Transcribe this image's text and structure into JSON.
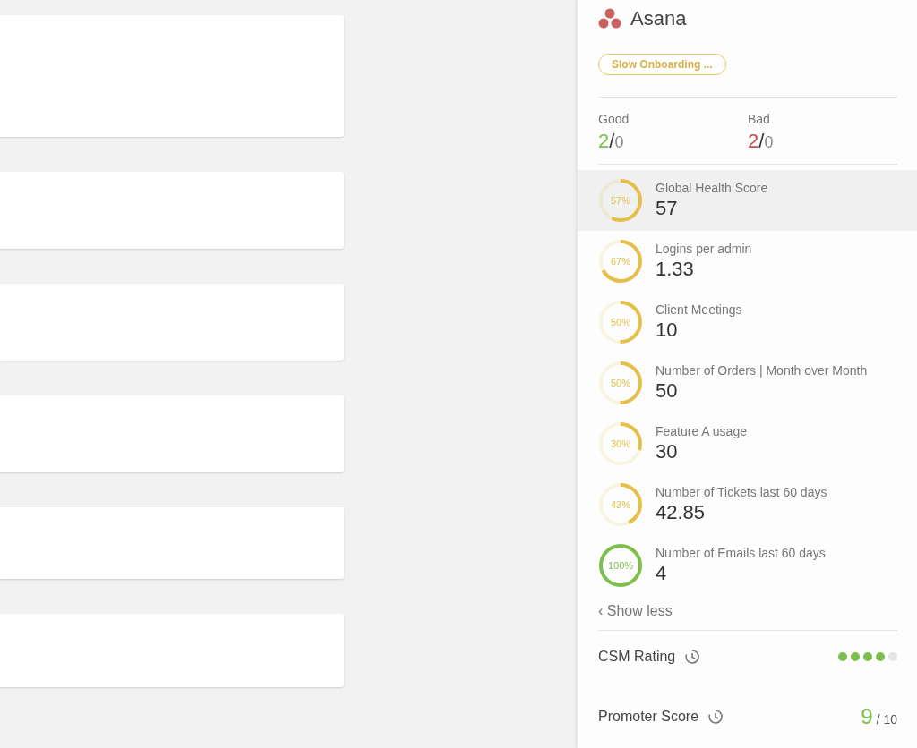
{
  "account": {
    "name": "Asana",
    "tag": "Slow Onboarding ..."
  },
  "tallies": [
    {
      "kind": "good",
      "label": "Good",
      "count": "2",
      "separator": "/",
      "total": "0"
    },
    {
      "kind": "bad",
      "label": "Bad",
      "count": "2",
      "separator": "/",
      "total": "0"
    }
  ],
  "metrics": [
    {
      "label": "Global Health Score",
      "value": "57",
      "percent": "57%",
      "color": "#e6bf4a",
      "highlighted": true
    },
    {
      "label": "Logins per admin",
      "value": "1.33",
      "percent": "67%",
      "color": "#e6bf4a",
      "highlighted": false
    },
    {
      "label": "Client Meetings",
      "value": "10",
      "percent": "50%",
      "color": "#e6bf4a",
      "highlighted": false
    },
    {
      "label": "Number of Orders | Month over Month",
      "value": "50",
      "percent": "50%",
      "color": "#e6bf4a",
      "highlighted": false
    },
    {
      "label": "Feature A usage",
      "value": "30",
      "percent": "30%",
      "color": "#e6bf4a",
      "highlighted": false
    },
    {
      "label": "Number of Tickets last 60 days",
      "value": "42.85",
      "percent": "43%",
      "color": "#e6bf4a",
      "highlighted": false
    },
    {
      "label": "Number of Emails last 60 days",
      "value": "4",
      "percent": "100%",
      "color": "#7cc04b",
      "highlighted": false
    }
  ],
  "toggle": "‹ Show less",
  "csm_rating": {
    "label": "CSM Rating",
    "stars": 4
  },
  "promoter_score": {
    "label": "Promoter Score",
    "score": "9",
    "out_of": "/ 10"
  }
}
